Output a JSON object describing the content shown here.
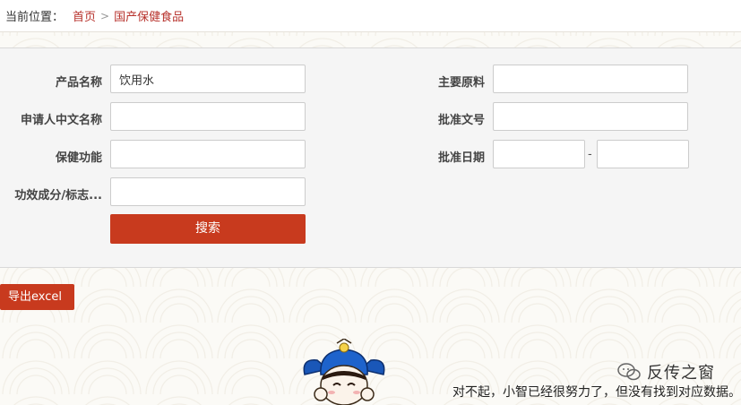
{
  "breadcrumb": {
    "label": "当前位置：",
    "home": "首页",
    "separator": ">",
    "current": "国产保健食品"
  },
  "form": {
    "product_name": {
      "label": "产品名称",
      "value": "饮用水"
    },
    "main_ingredients": {
      "label": "主要原料",
      "value": ""
    },
    "applicant_cn_name": {
      "label": "申请人中文名称",
      "value": ""
    },
    "approval_number": {
      "label": "批准文号",
      "value": ""
    },
    "health_function": {
      "label": "保健功能",
      "value": ""
    },
    "approval_date": {
      "label": "批准日期",
      "start": "",
      "end": "",
      "separator": "-"
    },
    "functional_component": {
      "label": "功效成分/标志...",
      "value": ""
    },
    "search_label": "搜索"
  },
  "export_label": "导出excel",
  "watermark": {
    "text": "反传之窗",
    "icon": "wechat-icon"
  },
  "empty_message": "对不起，小智已经很努力了，但没有找到对应数据。",
  "colors": {
    "accent": "#c83a1e",
    "link": "#b7322c"
  }
}
